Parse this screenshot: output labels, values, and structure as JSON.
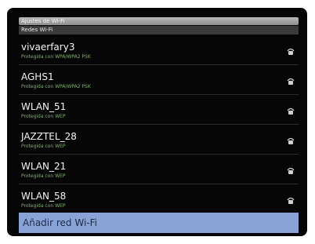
{
  "titlebar": {
    "title": "Ajustes de Wi-Fi"
  },
  "section": {
    "label": "Redes Wi-Fi"
  },
  "networks": [
    {
      "name": "vivaerfary3",
      "security": "Protegida con WPA/WPA2 PSK",
      "icon": "wifi-lock-icon"
    },
    {
      "name": "AGHS1",
      "security": "Protegida con WPA/WPA2 PSK",
      "icon": "wifi-lock-icon"
    },
    {
      "name": "WLAN_51",
      "security": "Protegida con WEP",
      "icon": "wifi-lock-icon"
    },
    {
      "name": "JAZZTEL_28",
      "security": "Protegida con WEP",
      "icon": "wifi-lock-icon"
    },
    {
      "name": "WLAN_21",
      "security": "Protegida con WEP",
      "icon": "wifi-lock-icon"
    },
    {
      "name": "WLAN_58",
      "security": "Protegida con WEP",
      "icon": "wifi-lock-icon"
    }
  ],
  "add_network": {
    "label": "Añadir red Wi-Fi"
  },
  "colors": {
    "background": "#060606",
    "security_text": "#7fb36a",
    "highlight": "#8aa3d6"
  }
}
